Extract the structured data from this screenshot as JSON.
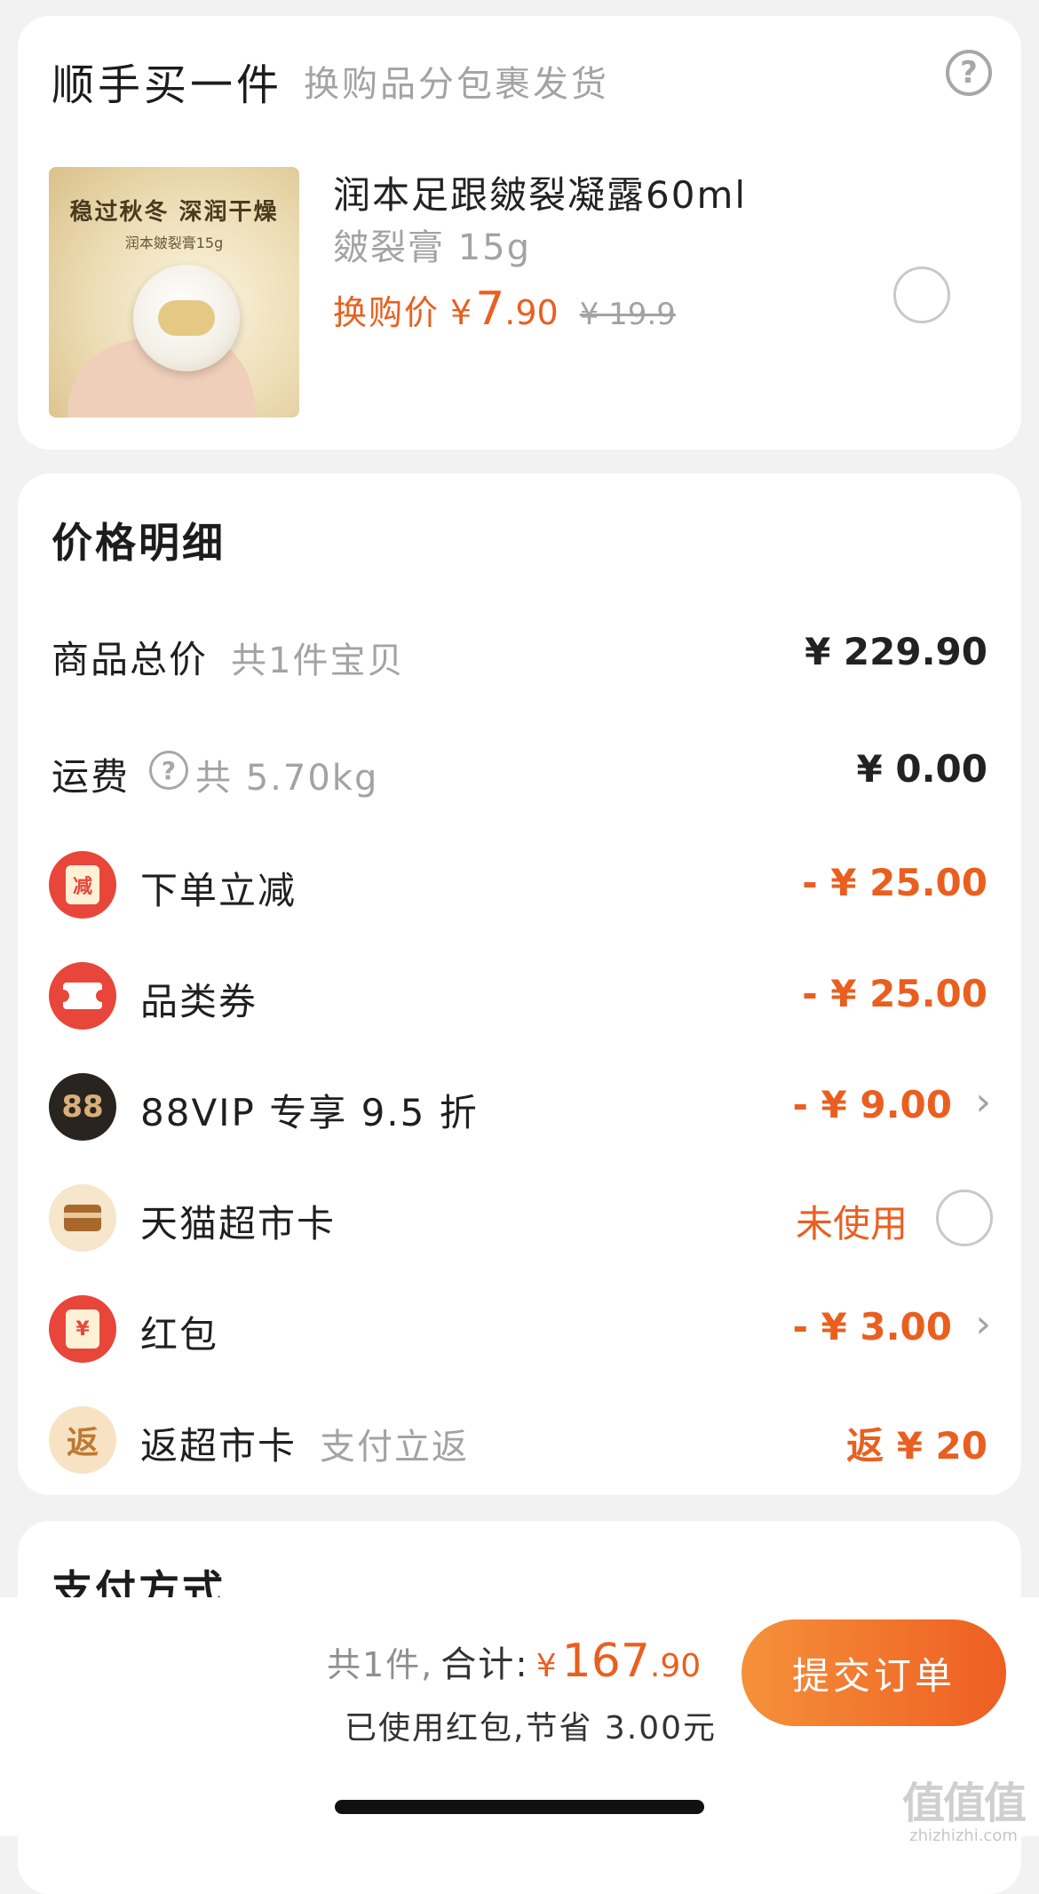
{
  "addon": {
    "title": "顺手买一件",
    "subtitle": "换购品分包裹发货",
    "product": {
      "image_headline": "稳过秋冬 深润干燥",
      "image_sub": "润本皴裂膏15g",
      "name": "润本足跟皴裂凝露60ml",
      "spec": "皴裂膏 15g",
      "price_label": "换购价",
      "currency": "¥",
      "price_int": "7",
      "price_dec": ".90",
      "original_price": "¥ 19.9"
    }
  },
  "price_detail": {
    "title": "价格明细",
    "rows": [
      {
        "label": "商品总价",
        "note": "共1件宝贝",
        "amount": "¥ 229.90"
      },
      {
        "label": "运费",
        "note": "共 5.70kg",
        "amount": "¥ 0.00"
      },
      {
        "label": "下单立减",
        "amount": "- ¥ 25.00",
        "badge_text": "减"
      },
      {
        "label": "品类券",
        "amount": "- ¥ 25.00"
      },
      {
        "label": "88VIP 专享 9.5 折",
        "amount": "- ¥ 9.00",
        "badge_text": "88"
      },
      {
        "label": "天猫超市卡",
        "amount": "未使用"
      },
      {
        "label": "红包",
        "amount": "- ¥ 3.00",
        "badge_text": "¥"
      },
      {
        "label": "返超市卡",
        "note": "支付立返",
        "amount": "返 ¥ 20",
        "badge_text": "返"
      }
    ]
  },
  "payment": {
    "title": "支付方式"
  },
  "footer": {
    "count": "共1件,",
    "total_label": "合计:",
    "currency": "¥",
    "total_int": "167",
    "total_dec": ".90",
    "saved": "已使用红包,节省 3.00元",
    "submit": "提交订单"
  },
  "watermark": {
    "mark": "值值值",
    "text": "zhizhizhi.com"
  },
  "colors": {
    "accent": "#ea5f1f",
    "badge_red": "#e8463a",
    "background": "#f2f2f2"
  },
  "icons": [
    "help-circle-icon",
    "reduce-badge-icon",
    "coupon-ticket-icon",
    "vip88-badge-icon",
    "supermarket-card-icon",
    "red-packet-icon",
    "cashback-badge-icon",
    "chevron-right-icon",
    "radio-unchecked-icon"
  ]
}
